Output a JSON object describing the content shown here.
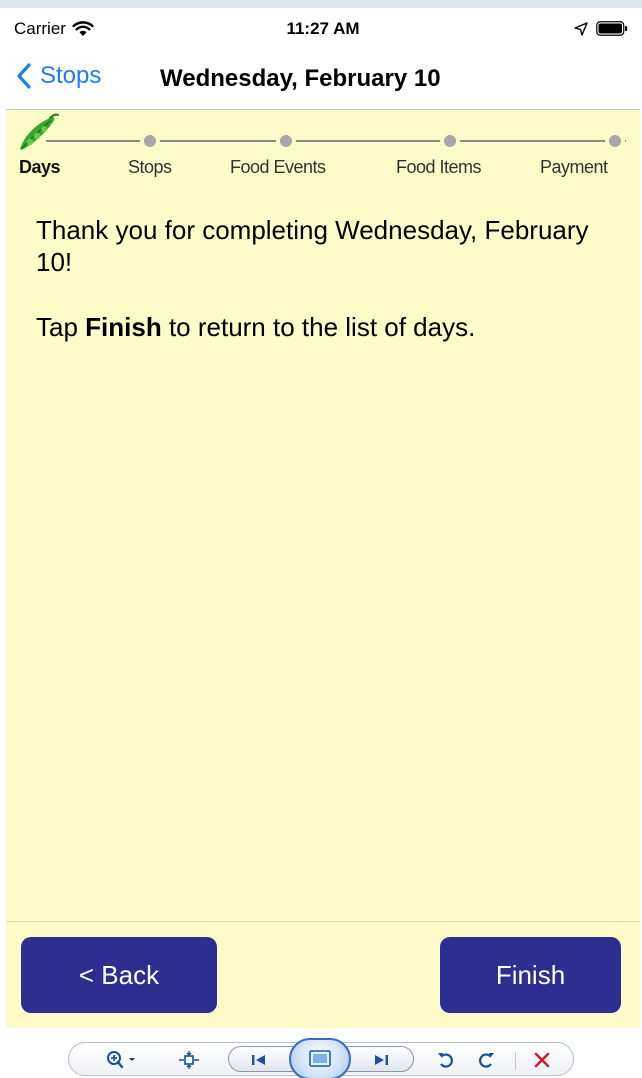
{
  "status_bar": {
    "carrier": "Carrier",
    "time": "11:27 AM"
  },
  "nav_bar": {
    "back_label": "Stops",
    "title": "Wednesday, February 10"
  },
  "stepper": {
    "steps": [
      {
        "label": "Days",
        "active": true
      },
      {
        "label": "Stops",
        "active": false
      },
      {
        "label": "Food Events",
        "active": false
      },
      {
        "label": "Food Items",
        "active": false
      },
      {
        "label": "Payment",
        "active": false
      }
    ],
    "current_step_icon": "pea-pod-icon"
  },
  "content": {
    "message": "Thank you for completing Wednesday, February 10!",
    "instruction_prefix": "Tap ",
    "instruction_bold": "Finish",
    "instruction_suffix": " to return to the list of days."
  },
  "buttons": {
    "back_label": "< Back",
    "finish_label": "Finish"
  },
  "colors": {
    "background": "#fdfcc8",
    "accent_blue": "#1e7cf3",
    "button_navy": "#2e2e90",
    "pea_green": "#3aa531"
  },
  "viewer_toolbar": {
    "icons": [
      "zoom-in-icon",
      "actual-size-icon",
      "previous-icon",
      "slideshow-icon",
      "next-icon",
      "rotate-counterclockwise-icon",
      "rotate-clockwise-icon",
      "delete-icon"
    ]
  }
}
